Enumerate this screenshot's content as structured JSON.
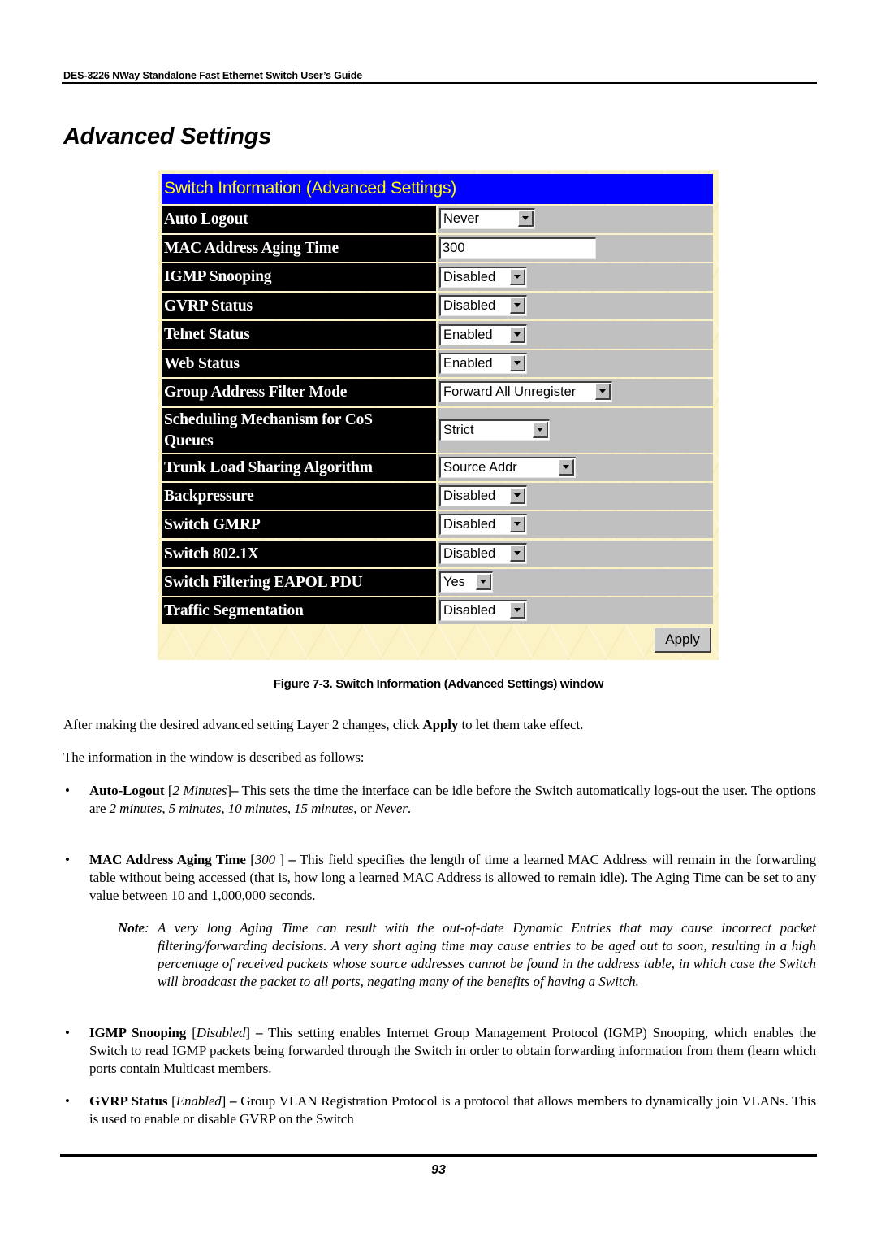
{
  "running_header": "DES-3226 NWay Standalone Fast Ethernet Switch User’s Guide",
  "section_title": "Advanced Settings",
  "figure": {
    "header": "Switch Information (Advanced Settings)",
    "rows": [
      {
        "label": "Auto Logout",
        "type": "select",
        "value": "Never"
      },
      {
        "label": "MAC Address Aging Time",
        "type": "text",
        "value": "300"
      },
      {
        "label": "IGMP Snooping",
        "type": "select",
        "value": "Disabled"
      },
      {
        "label": "GVRP Status",
        "type": "select",
        "value": "Disabled"
      },
      {
        "label": "Telnet Status",
        "type": "select",
        "value": "Enabled"
      },
      {
        "label": "Web Status",
        "type": "select",
        "value": "Enabled"
      },
      {
        "label": "Group Address Filter Mode",
        "type": "select",
        "value": "Forward All Unregister"
      },
      {
        "label_line1": "Scheduling Mechanism for CoS",
        "label_line2": "Queues",
        "type": "select",
        "value": "Strict"
      },
      {
        "label": "Trunk Load Sharing Algorithm",
        "type": "select",
        "value": "Source Addr"
      },
      {
        "label": "Backpressure",
        "type": "select",
        "value": "Disabled"
      },
      {
        "label": "Switch GMRP",
        "type": "select",
        "value": "Disabled"
      },
      {
        "label": "Switch 802.1X",
        "type": "select",
        "value": "Disabled"
      },
      {
        "label": "Switch Filtering EAPOL PDU",
        "type": "select",
        "value": "Yes"
      },
      {
        "label": "Traffic Segmentation",
        "type": "select",
        "value": "Disabled"
      }
    ],
    "apply_label": "Apply",
    "colors": {
      "header_bg": "#0000ff",
      "header_text": "#ffff00",
      "label_bg": "#000000",
      "label_text": "#ffffff",
      "value_bg": "#c0c0c0",
      "panel_bg": "#fbf3c6"
    }
  },
  "caption": "Figure 7-3.  Switch Information (Advanced Settings) window",
  "body": {
    "intro": {
      "before": "After making the desired advanced setting Layer 2 changes, click ",
      "bold": "Apply",
      "after": " to let them take effect."
    },
    "intro2": "The information in the window is described as follows:",
    "bullets": [
      {
        "term": "Auto-Logout",
        "default": "2 Minutes",
        "text_a": " This sets the time the interface can be idle before the Switch automatically logs-out the user. The options are ",
        "options": [
          "2 minutes",
          "5 minutes",
          "10 minutes",
          "15 minutes"
        ],
        "or": ", or ",
        "last_option": "Never",
        "end": "."
      },
      {
        "term": "MAC Address Aging Time",
        "default": "300",
        "text": " This field specifies the length of time a learned MAC Address will remain in the forwarding table without being accessed (that is, how long a learned MAC Address is allowed to remain idle). The Aging Time can be set to any value between 10 and 1,000,000 seconds."
      },
      {
        "term": "IGMP Snooping",
        "default": "Disabled",
        "text": " This setting enables Internet Group Management Protocol (IGMP) Snooping, which enables the Switch to read IGMP packets being forwarded through the Switch in order to obtain forwarding information from them (learn which ports contain Multicast members."
      },
      {
        "term": "GVRP Status",
        "default": "Enabled",
        "text": " Group VLAN Registration Protocol is a protocol that allows members to dynamically join VLANs. This is used to enable or disable GVRP on the Switch"
      }
    ],
    "note": {
      "label": "Note",
      "text": "A very long Aging Time can result with the out-of-date Dynamic Entries that may cause incorrect packet filtering/forwarding decisions. A very short aging time may cause entries to be aged out to soon, resulting in a high percentage of received packets whose source addresses cannot be found in the address table, in which case the Switch will broadcast the packet to all ports, negating many of the benefits of having a Switch."
    },
    "bullet_glyph": "•"
  },
  "page_number": "93"
}
